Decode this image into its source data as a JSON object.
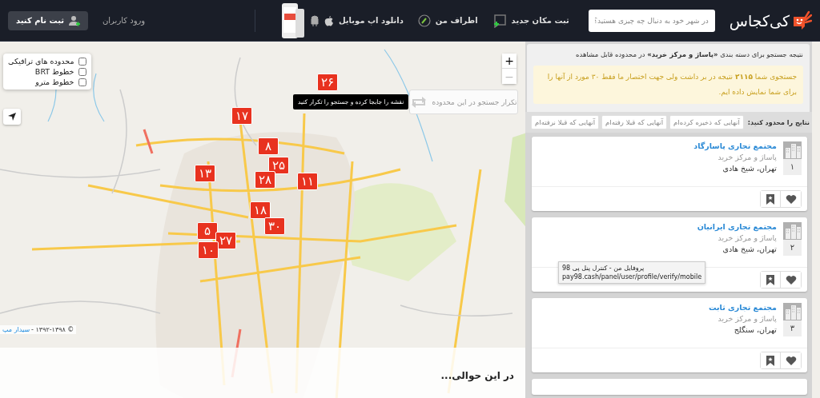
{
  "header": {
    "logo": "کی‌کجاس",
    "search": {
      "placeholder": "در شهر خود به دنبال چه چیزی هستید؟"
    },
    "nav": [
      {
        "kind": "add-place",
        "label": "ثبت مکان جدید"
      },
      {
        "kind": "nearby",
        "label": "اطراف من"
      },
      {
        "kind": "app",
        "label": "دانلود اپ موبایل"
      }
    ],
    "login": "ورود کاربران",
    "signup": "ثبت نام کنید"
  },
  "map": {
    "layers": [
      {
        "label": "محدوده های ترافیکی",
        "checked": false
      },
      {
        "label": "خطوط BRT",
        "checked": false
      },
      {
        "label": "خطوط مترو",
        "checked": false
      }
    ],
    "zoom_in": "+",
    "zoom_out": "−",
    "redo_search": "تکرار جستجو در این محدوده",
    "hint": "نقشه را جابجا کرده و جستجو را تکرار کنید",
    "markers": [
      "۲۶",
      "۱۷",
      "۸",
      "۱۳",
      "۲۵",
      "۲۸",
      "۱۱",
      "۱۸",
      "۳۰",
      "۵",
      "۲۷",
      "۱۰"
    ],
    "attribution": {
      "text": "© ۱۳۹۲-۱۳۹۸ -",
      "link": "سیدار مپ"
    },
    "nearby_title": "در این حوالی..."
  },
  "results": {
    "heading": "نتیجه جستجو برای دسته بندی **«پاساژ و مرکز خرید»** در محدوده قابل مشاهده",
    "notice": "جستجوی شما **۲۱۱۵** نتیجه در بر داشت ولی جهت اختصار ما فقط ۳۰ مورد از آنها را برای شما نمایش داده ایم.",
    "filter_label": "نتایج را محدود کنید:",
    "filters": [
      {
        "label": "آنهایی که ذخیره کرده‌ام",
        "selected": false
      },
      {
        "label": "آنهایی که قبلا رفته‌ام",
        "selected": false
      },
      {
        "label": "آنهایی که قبلا نرفته‌ام",
        "selected": false
      }
    ],
    "places": [
      {
        "rank": "۱",
        "name": "مجتمع تجاری پاسارگاد",
        "category": "پاساژ و مرکز خرید",
        "address": "تهران، شیخ هادی"
      },
      {
        "rank": "۲",
        "name": "مجتمع تجاری ایرانیان",
        "category": "پاساژ و مرکز خرید",
        "address": "تهران، شیخ هادی"
      },
      {
        "rank": "۳",
        "name": "مجتمع تجاری ثابت",
        "category": "پاساژ و مرکز خرید",
        "address": "تهران، سنگلج"
      }
    ]
  },
  "browser_tooltip": {
    "title": "پروفایل من - کنترل پنل پی 98",
    "url": "pay98.cash/panel/user/profile/verify/mobile"
  }
}
